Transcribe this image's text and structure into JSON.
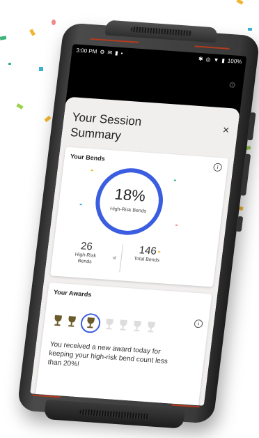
{
  "status_bar": {
    "time": "3:00 PM",
    "battery": "100%"
  },
  "sheet": {
    "title": "Your Session Summary",
    "close_label": "×"
  },
  "bends_card": {
    "title": "Your Bends",
    "percent": "18%",
    "percent_label": "High-Risk Bends",
    "high_risk_count": "26",
    "high_risk_label": "High-Risk Bends",
    "of_label": "of",
    "total_count": "146",
    "total_label": "Total Bends"
  },
  "awards_card": {
    "title": "Your Awards",
    "message": "You received a new award today for keeping your high-risk bend count less than 20%!",
    "trophies_won": 3,
    "trophies_total": 7
  },
  "colors": {
    "accent": "#3b5de0",
    "trophy_won": "#6b5a2a",
    "trophy_empty": "#dddddd"
  }
}
